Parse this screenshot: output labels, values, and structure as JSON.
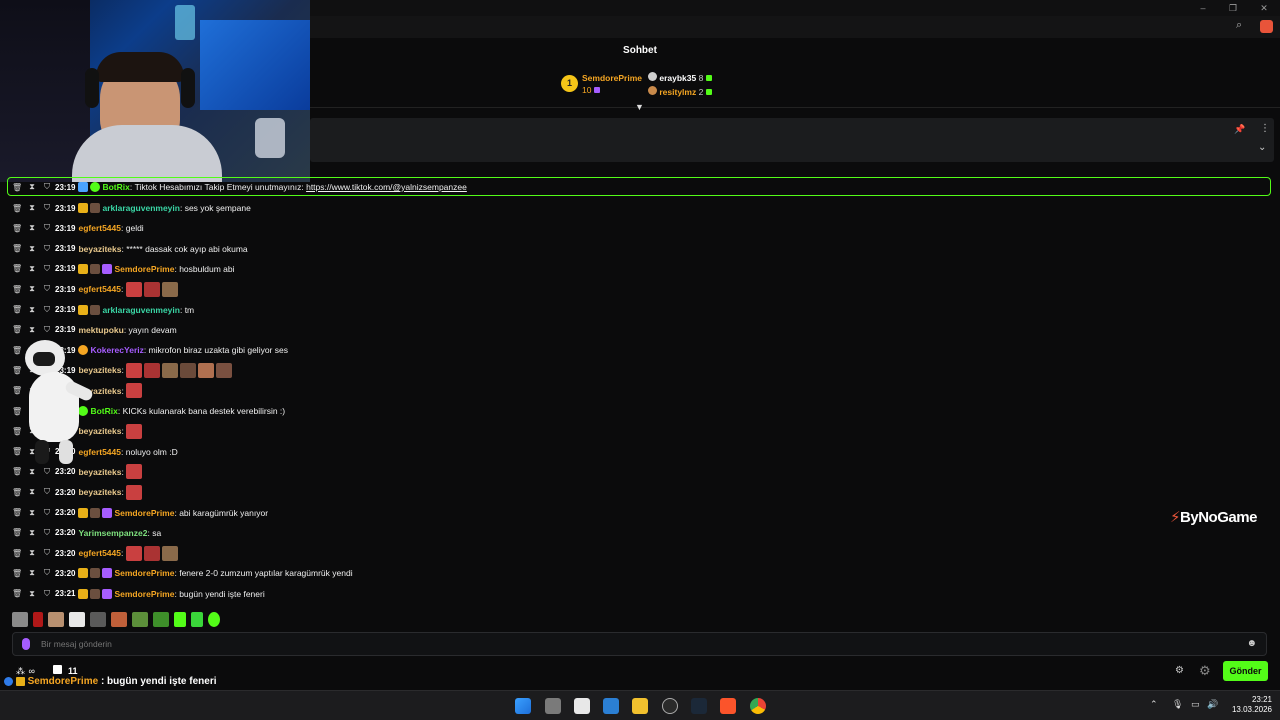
{
  "header": {
    "title": "Sohbet"
  },
  "leaderboard": {
    "first": {
      "rank": "1",
      "name": "SemdorePrime",
      "count": "10"
    },
    "others": [
      {
        "name": "eraybk35",
        "count": "8",
        "color": "#ffffff"
      },
      {
        "name": "resitylmz",
        "count": "2",
        "color": "#f5a623"
      }
    ]
  },
  "pinned_message": {
    "time": "23:19",
    "user": "BotRix",
    "text": "Tiktok Hesabımızı Takip Etmeyi unutmayınız:",
    "link": "https://www.tiktok.com/@yalnizsempanzee"
  },
  "chat": [
    {
      "time": "23:19",
      "user": "arklaraguvenmeyin",
      "color": "#3ad6a5",
      "text": "ses yok şempane",
      "badges": [
        "crown",
        "sub"
      ]
    },
    {
      "time": "23:19",
      "user": "egfert5445",
      "color": "#f5a623",
      "text": "geldi",
      "badges": []
    },
    {
      "time": "23:19",
      "user": "beyaziteks",
      "color": "#e8c88c",
      "text": "***** dassak cok ayıp abi okuma",
      "badges": []
    },
    {
      "time": "23:19",
      "user": "SemdorePrime",
      "color": "#f5a623",
      "text": "hosbuldum abi",
      "badges": [
        "crown",
        "sub",
        "gift"
      ]
    },
    {
      "time": "23:19",
      "user": "egfert5445",
      "color": "#f5a623",
      "text": "",
      "emotes": 3,
      "badges": []
    },
    {
      "time": "23:19",
      "user": "arklaraguvenmeyin",
      "color": "#3ad6a5",
      "text": "tm",
      "badges": [
        "crown",
        "sub"
      ]
    },
    {
      "time": "23:19",
      "user": "mektupoku",
      "color": "#e8c88c",
      "text": "yayın devam",
      "badges": []
    },
    {
      "time": "23:19",
      "user": "KokerecYeriz",
      "color": "#a65dff",
      "text": "mikrofon biraz uzakta gibi geliyor ses",
      "badges": [
        "coin"
      ]
    },
    {
      "time": "23:19",
      "user": "beyaziteks",
      "color": "#e8c88c",
      "text": "",
      "emotes": 6,
      "badges": []
    },
    {
      "time": "23:19",
      "user": "beyaziteks",
      "color": "#e8c88c",
      "text": "",
      "emotes": 1,
      "badges": []
    },
    {
      "time": "23:19",
      "user": "BotRix",
      "color": "#53fc18",
      "text": "KICKs kulanarak bana destek verebilirsin :)",
      "badges": [
        "bot"
      ]
    },
    {
      "time": "23:19",
      "user": "beyaziteks",
      "color": "#e8c88c",
      "text": "",
      "emotes": 1,
      "badges": []
    },
    {
      "time": "23:20",
      "user": "egfert5445",
      "color": "#f5a623",
      "text": "noluyo olm :D",
      "badges": []
    },
    {
      "time": "23:20",
      "user": "beyaziteks",
      "color": "#e8c88c",
      "text": "",
      "emotes": 1,
      "badges": []
    },
    {
      "time": "23:20",
      "user": "beyaziteks",
      "color": "#e8c88c",
      "text": "",
      "emotes": 1,
      "badges": []
    },
    {
      "time": "23:20",
      "user": "SemdorePrime",
      "color": "#f5a623",
      "text": "abi karagümrük yanıyor",
      "badges": [
        "crown",
        "sub",
        "gift"
      ]
    },
    {
      "time": "23:20",
      "user": "Yarimsempanze2",
      "color": "#7ee07e",
      "text": "sa",
      "badges": []
    },
    {
      "time": "23:20",
      "user": "egfert5445",
      "color": "#f5a623",
      "text": "",
      "emotes": 3,
      "badges": []
    },
    {
      "time": "23:20",
      "user": "SemdorePrime",
      "color": "#f5a623",
      "text": "fenere 2-0 zumzum yaptılar karagümrük yendi",
      "badges": [
        "crown",
        "sub",
        "gift"
      ]
    },
    {
      "time": "23:21",
      "user": "SemdorePrime",
      "color": "#f5a623",
      "text": "bugün yendi işte feneri",
      "badges": [
        "crown",
        "sub",
        "gift"
      ]
    }
  ],
  "input": {
    "placeholder": "Bir mesaj gönderin"
  },
  "footer": {
    "viewers": "11",
    "send_label": "Gönder",
    "overlay_user": "SemdorePrime",
    "overlay_text": ": bugün yendi işte feneri"
  },
  "watermark": "ByNoGame",
  "taskbar": {
    "time": "23:21",
    "date": "13.03.2026"
  },
  "colors": {
    "accent": "#53fc18",
    "bg": "#0b0b0c"
  }
}
